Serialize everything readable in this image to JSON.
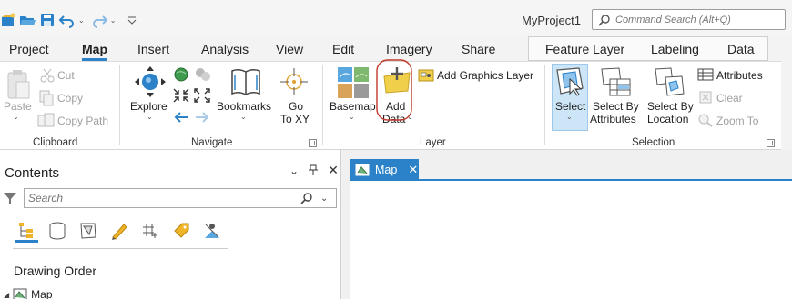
{
  "titlebar": {
    "project_name": "MyProject1",
    "command_search_placeholder": "Command Search (Alt+Q)"
  },
  "tabs": [
    "Project",
    "Map",
    "Insert",
    "Analysis",
    "View",
    "Edit",
    "Imagery",
    "Share"
  ],
  "active_tab": "Map",
  "context_tabs": [
    "Feature Layer",
    "Labeling",
    "Data"
  ],
  "clipboard": {
    "paste": "Paste",
    "cut": "Cut",
    "copy": "Copy",
    "copy_path": "Copy Path",
    "group": "Clipboard"
  },
  "navigate": {
    "explore": "Explore",
    "bookmarks": "Bookmarks",
    "go_line1": "Go",
    "go_line2": "To XY",
    "group": "Navigate"
  },
  "layer": {
    "basemap": "Basemap",
    "add_line1": "Add",
    "add_line2": "Data",
    "add_graphics": "Add Graphics Layer",
    "group": "Layer"
  },
  "selection": {
    "select": "Select",
    "select_by_attr_1": "Select By",
    "select_by_attr_2": "Attributes",
    "select_by_loc_1": "Select By",
    "select_by_loc_2": "Location",
    "attributes": "Attributes",
    "clear": "Clear",
    "zoom_to": "Zoom To",
    "group": "Selection"
  },
  "contents": {
    "title": "Contents",
    "search_placeholder": "Search",
    "drawing_order": "Drawing Order",
    "tree_item": "Map"
  },
  "mapview": {
    "tab_label": "Map"
  },
  "colors": {
    "accent": "#2b82c8",
    "highlight": "#cde6f7",
    "annotation": "#c0392b"
  }
}
